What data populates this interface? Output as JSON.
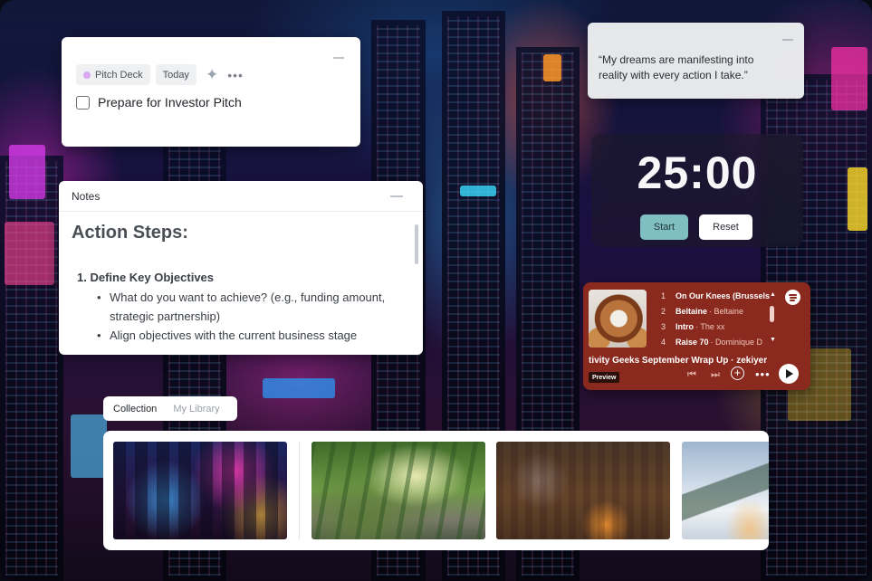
{
  "task": {
    "tag_label": "Pitch Deck",
    "date_label": "Today",
    "title": "Prepare for Investor Pitch",
    "icons": {
      "sparkle": "sparkle-icon",
      "more": "more-icon",
      "minimize": "minimize-icon"
    }
  },
  "notes": {
    "title": "Notes",
    "heading": "Action Steps:",
    "item1": "1. Define Key Objectives",
    "bullet1": "What do you want to achieve? (e.g., funding amount, strategic partnership)",
    "bullet2": "Align objectives with the current business stage"
  },
  "quote": {
    "text": "“My dreams are manifesting into reality with every action I take.”"
  },
  "timer": {
    "time": "25:00",
    "start_label": "Start",
    "reset_label": "Reset",
    "start_color": "#7fbfc2"
  },
  "player": {
    "tracks": [
      {
        "num": "1",
        "title": "On Our Knees (Brussels S",
        "artist": ""
      },
      {
        "num": "2",
        "title": "Beltaine",
        "artist": "· Beltaine"
      },
      {
        "num": "3",
        "title": "Intro",
        "artist": "· The xx"
      },
      {
        "num": "4",
        "title": "Raise 70",
        "artist": "· Dominique D"
      }
    ],
    "playlist": "tivity Geeks September Wrap Up · zekiyer",
    "preview_label": "Preview",
    "bg_color": "#8a2a1e"
  },
  "library": {
    "tab_collection": "Collection",
    "tab_my_library": "My Library"
  }
}
